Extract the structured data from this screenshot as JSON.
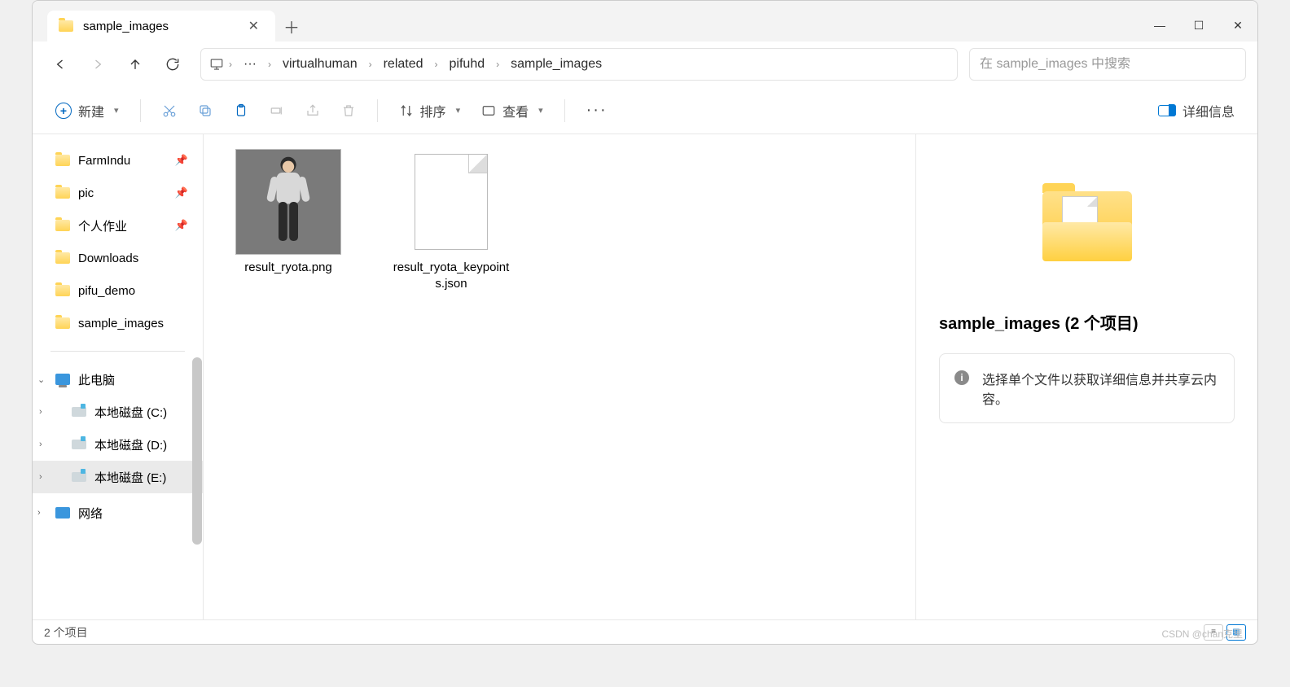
{
  "titlebar": {
    "tab_title": "sample_images"
  },
  "window_controls": {
    "minimize": "—",
    "maximize": "☐",
    "close": "✕"
  },
  "breadcrumb": {
    "root_icon": "monitor",
    "ellipsis": "···",
    "segments": [
      "virtualhuman",
      "related",
      "pifuhd",
      "sample_images"
    ]
  },
  "search": {
    "placeholder": "在 sample_images 中搜索"
  },
  "toolbar": {
    "new_label": "新建",
    "sort_label": "排序",
    "view_label": "查看",
    "details_label": "详细信息"
  },
  "sidebar": {
    "quick": [
      {
        "name": "FarmIndu",
        "pinned": true
      },
      {
        "name": "pic",
        "pinned": true
      },
      {
        "name": "个人作业",
        "pinned": true
      },
      {
        "name": "Downloads",
        "pinned": false
      },
      {
        "name": "pifu_demo",
        "pinned": false
      },
      {
        "name": "sample_images",
        "pinned": false
      }
    ],
    "this_pc": "此电脑",
    "drives": [
      {
        "name": "本地磁盘 (C:)"
      },
      {
        "name": "本地磁盘 (D:)"
      },
      {
        "name": "本地磁盘 (E:)",
        "selected": true
      }
    ],
    "network": "网络"
  },
  "files": [
    {
      "name": "result_ryota.png",
      "type": "image"
    },
    {
      "name": "result_ryota_keypoints.json",
      "type": "file"
    }
  ],
  "details_pane": {
    "title": "sample_images (2 个项目)",
    "hint": "选择单个文件以获取详细信息并共享云内容。"
  },
  "statusbar": {
    "count": "2 个项目"
  },
  "watermark": "CSDN @chan克里"
}
